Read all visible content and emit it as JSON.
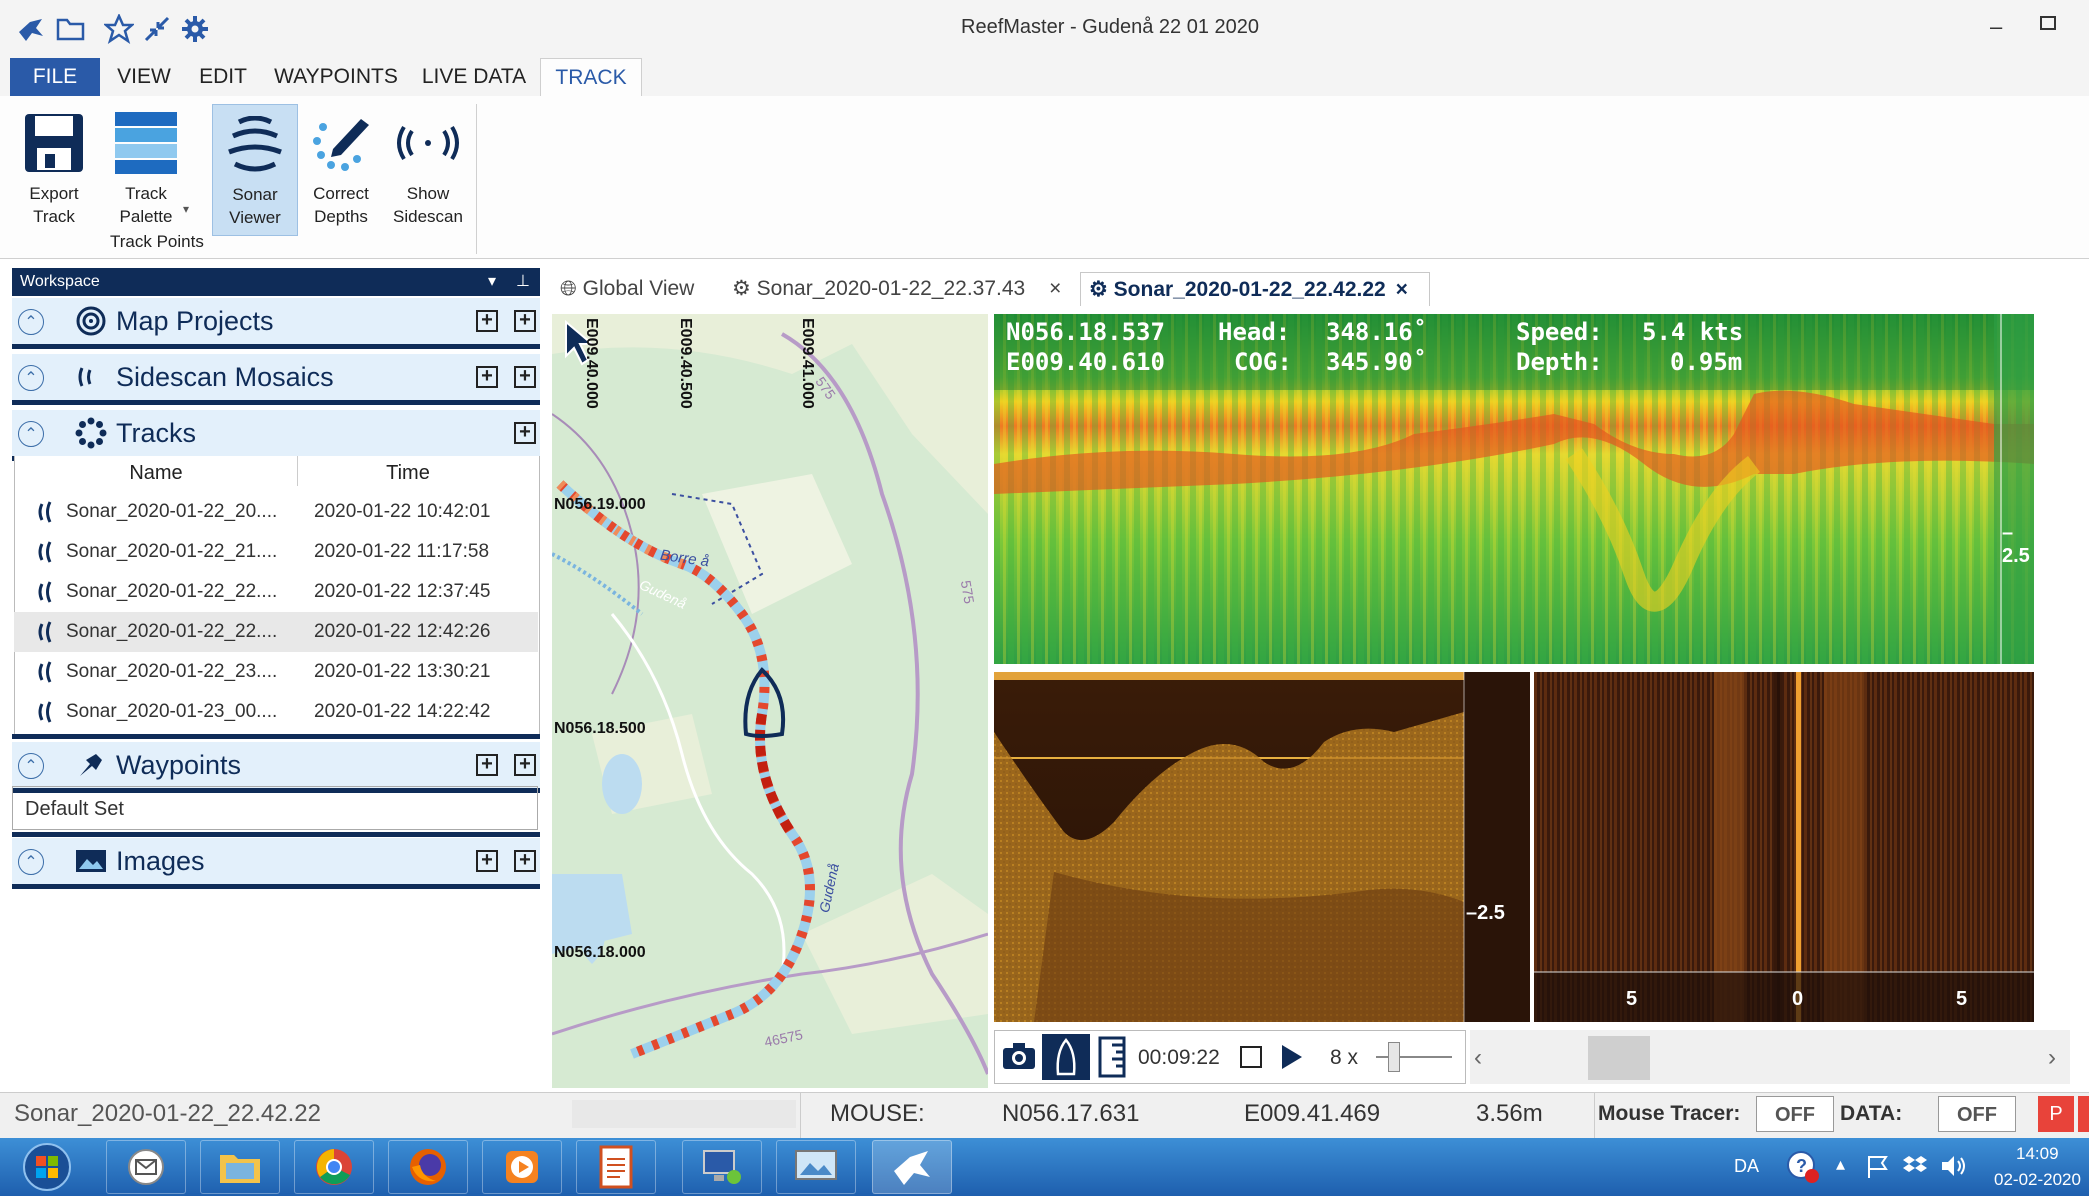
{
  "window": {
    "title": "ReefMaster - Gudenå 22 01 2020"
  },
  "menu": [
    "FILE",
    "VIEW",
    "EDIT",
    "WAYPOINTS",
    "LIVE DATA",
    "TRACK"
  ],
  "ribbon": {
    "export": [
      "Export",
      "Track"
    ],
    "palette": [
      "Track",
      "Palette"
    ],
    "sonar": [
      "Sonar",
      "Viewer"
    ],
    "correct": [
      "Correct",
      "Depths"
    ],
    "sidescan": [
      "Show",
      "Sidescan"
    ],
    "group": "Track Points"
  },
  "workspace": {
    "title": "Workspace",
    "sections": {
      "map_projects": "Map Projects",
      "sidescan": "Sidescan Mosaics",
      "tracks": "Tracks",
      "waypoints": "Waypoints",
      "images": "Images"
    },
    "tracks_columns": [
      "Name",
      "Time"
    ],
    "tracks": [
      {
        "name": "Sonar_2020-01-22_20....",
        "time": "2020-01-22 10:42:01"
      },
      {
        "name": "Sonar_2020-01-22_21....",
        "time": "2020-01-22 11:17:58"
      },
      {
        "name": "Sonar_2020-01-22_22....",
        "time": "2020-01-22 12:37:45"
      },
      {
        "name": "Sonar_2020-01-22_22....",
        "time": "2020-01-22 12:42:26"
      },
      {
        "name": "Sonar_2020-01-22_23....",
        "time": "2020-01-22 13:30:21"
      },
      {
        "name": "Sonar_2020-01-23_00....",
        "time": "2020-01-22 14:22:42"
      }
    ],
    "default_set": "Default Set"
  },
  "tabs": [
    "Global View",
    "Sonar_2020-01-22_22.37.43",
    "Sonar_2020-01-22_22.42.22"
  ],
  "map": {
    "lon_labels": [
      "E009.40.000",
      "E009.40.500",
      "E009.41.000"
    ],
    "lat_labels": [
      "N056.19.000",
      "N056.18.500",
      "N056.18.000"
    ],
    "place_labels": [
      "Borre å",
      "Gudenå",
      "Gudenå",
      "575",
      "575",
      "46575"
    ]
  },
  "sonar": {
    "lat": "N056.18.537",
    "lon": "E009.40.610",
    "head_label": "Head:",
    "head": "348.16˚",
    "cog_label": "COG:",
    "cog": "345.90˚",
    "speed_label": "Speed:",
    "speed": "5.4 kts",
    "depth_label": "Depth:",
    "depth": "0.95m",
    "scale_top": "2.5",
    "scale_bl": "2.5",
    "side_ticks": [
      "5",
      "0",
      "5"
    ]
  },
  "playback": {
    "time": "00:09:22",
    "speed": "8 x"
  },
  "status": {
    "track": "Sonar_2020-01-22_22.42.22",
    "mouse_label": "MOUSE:",
    "mouse_lat": "N056.17.631",
    "mouse_lon": "E009.41.469",
    "mouse_depth": "3.56m",
    "tracer_label": "Mouse Tracer:",
    "tracer": "OFF",
    "data_label": "DATA:",
    "data": "OFF",
    "p": "P"
  },
  "tray": {
    "lang": "DA",
    "time": "14:09",
    "date": "02-02-2020"
  }
}
